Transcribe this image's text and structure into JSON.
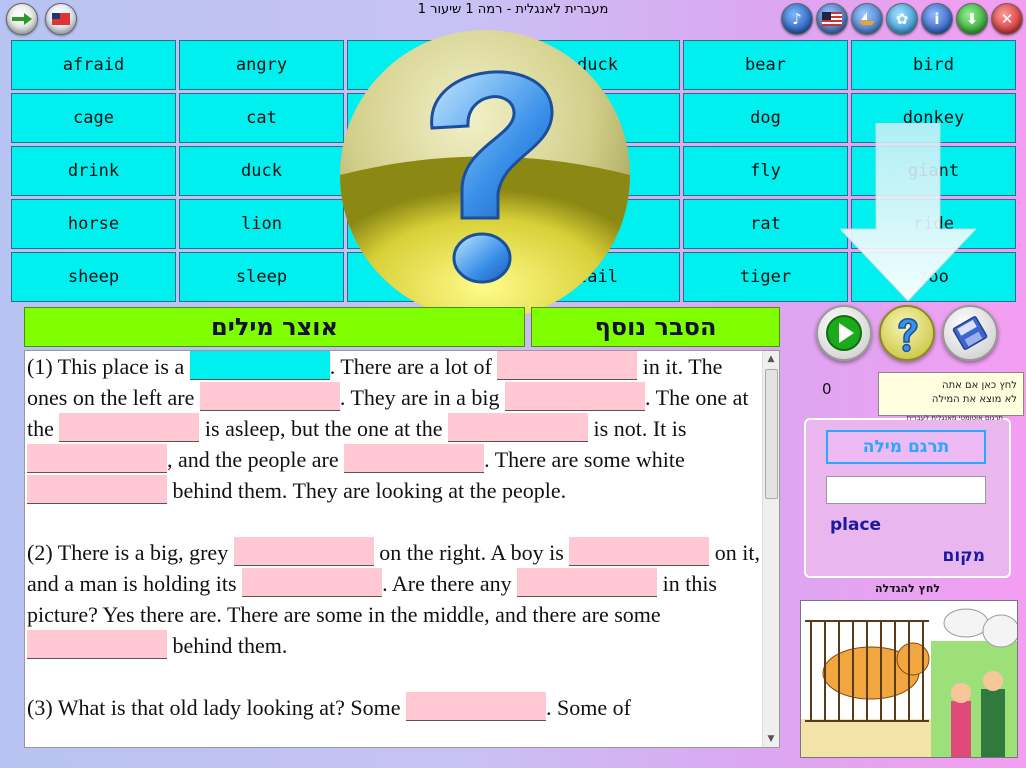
{
  "window": {
    "title": "מעברית לאנגלית -  רמה 1 שיעור 1"
  },
  "toolbar": {
    "icons": [
      "arrow-icon",
      "flag-icon",
      "music-icon",
      "us-flag-icon",
      "boat-icon",
      "settings-icon",
      "info-icon",
      "download-icon",
      "close-icon"
    ]
  },
  "words": [
    [
      "afraid",
      "angry",
      "",
      "duck",
      "bear",
      "bird"
    ],
    [
      "cage",
      "cat",
      "",
      "",
      "dog",
      "donkey"
    ],
    [
      "drink",
      "duck",
      "",
      "",
      "fly",
      "giant"
    ],
    [
      "horse",
      "lion",
      "",
      "",
      "rat",
      "ride"
    ],
    [
      "sheep",
      "sleep",
      "",
      "tail",
      "tiger",
      "zoo"
    ]
  ],
  "headings": {
    "vocabulary": "אוצר מילים",
    "explanation": "הסבר נוסף"
  },
  "passage": {
    "p1_a": "(1)  This place is a ",
    "p1_b": ". There are a lot of ",
    "p1_c": " in it. The ones on the left are ",
    "p1_d": ". They are in a big ",
    "p1_e": ". The one at the ",
    "p1_f": " is asleep, but the one at the ",
    "p1_g": " is not. It is ",
    "p1_h": ", and the people are ",
    "p1_i": ". There are some white ",
    "p1_j": " behind them. They are looking at the people.",
    "p2_a": "(2)  There is a big, grey ",
    "p2_b": " on the right. A boy is ",
    "p2_c": " on it, and a man is holding its ",
    "p2_d": ". Are there any ",
    "p2_e": " in this picture? Yes there are. There are some in the middle, and there are some ",
    "p2_f": " behind them.",
    "p3_a": "(3)  What is that old lady looking at? Some ",
    "p3_b": ". Some of"
  },
  "score": "0",
  "tooltip": {
    "line1": "לחץ כאן אם אתה",
    "line2": "לא מוצא את המילה"
  },
  "toolbox": {
    "tiny_label": "תרגום אוטומטי מאנגלית לעברית",
    "translate_label": "תרגם מילה",
    "word_en": "place",
    "word_he": "מקום"
  },
  "image_caption": "לחץ להגדלה",
  "colors": {
    "word_cell": "#00f0f0",
    "blank": "#ffc8d2",
    "heading": "#80ff00"
  }
}
